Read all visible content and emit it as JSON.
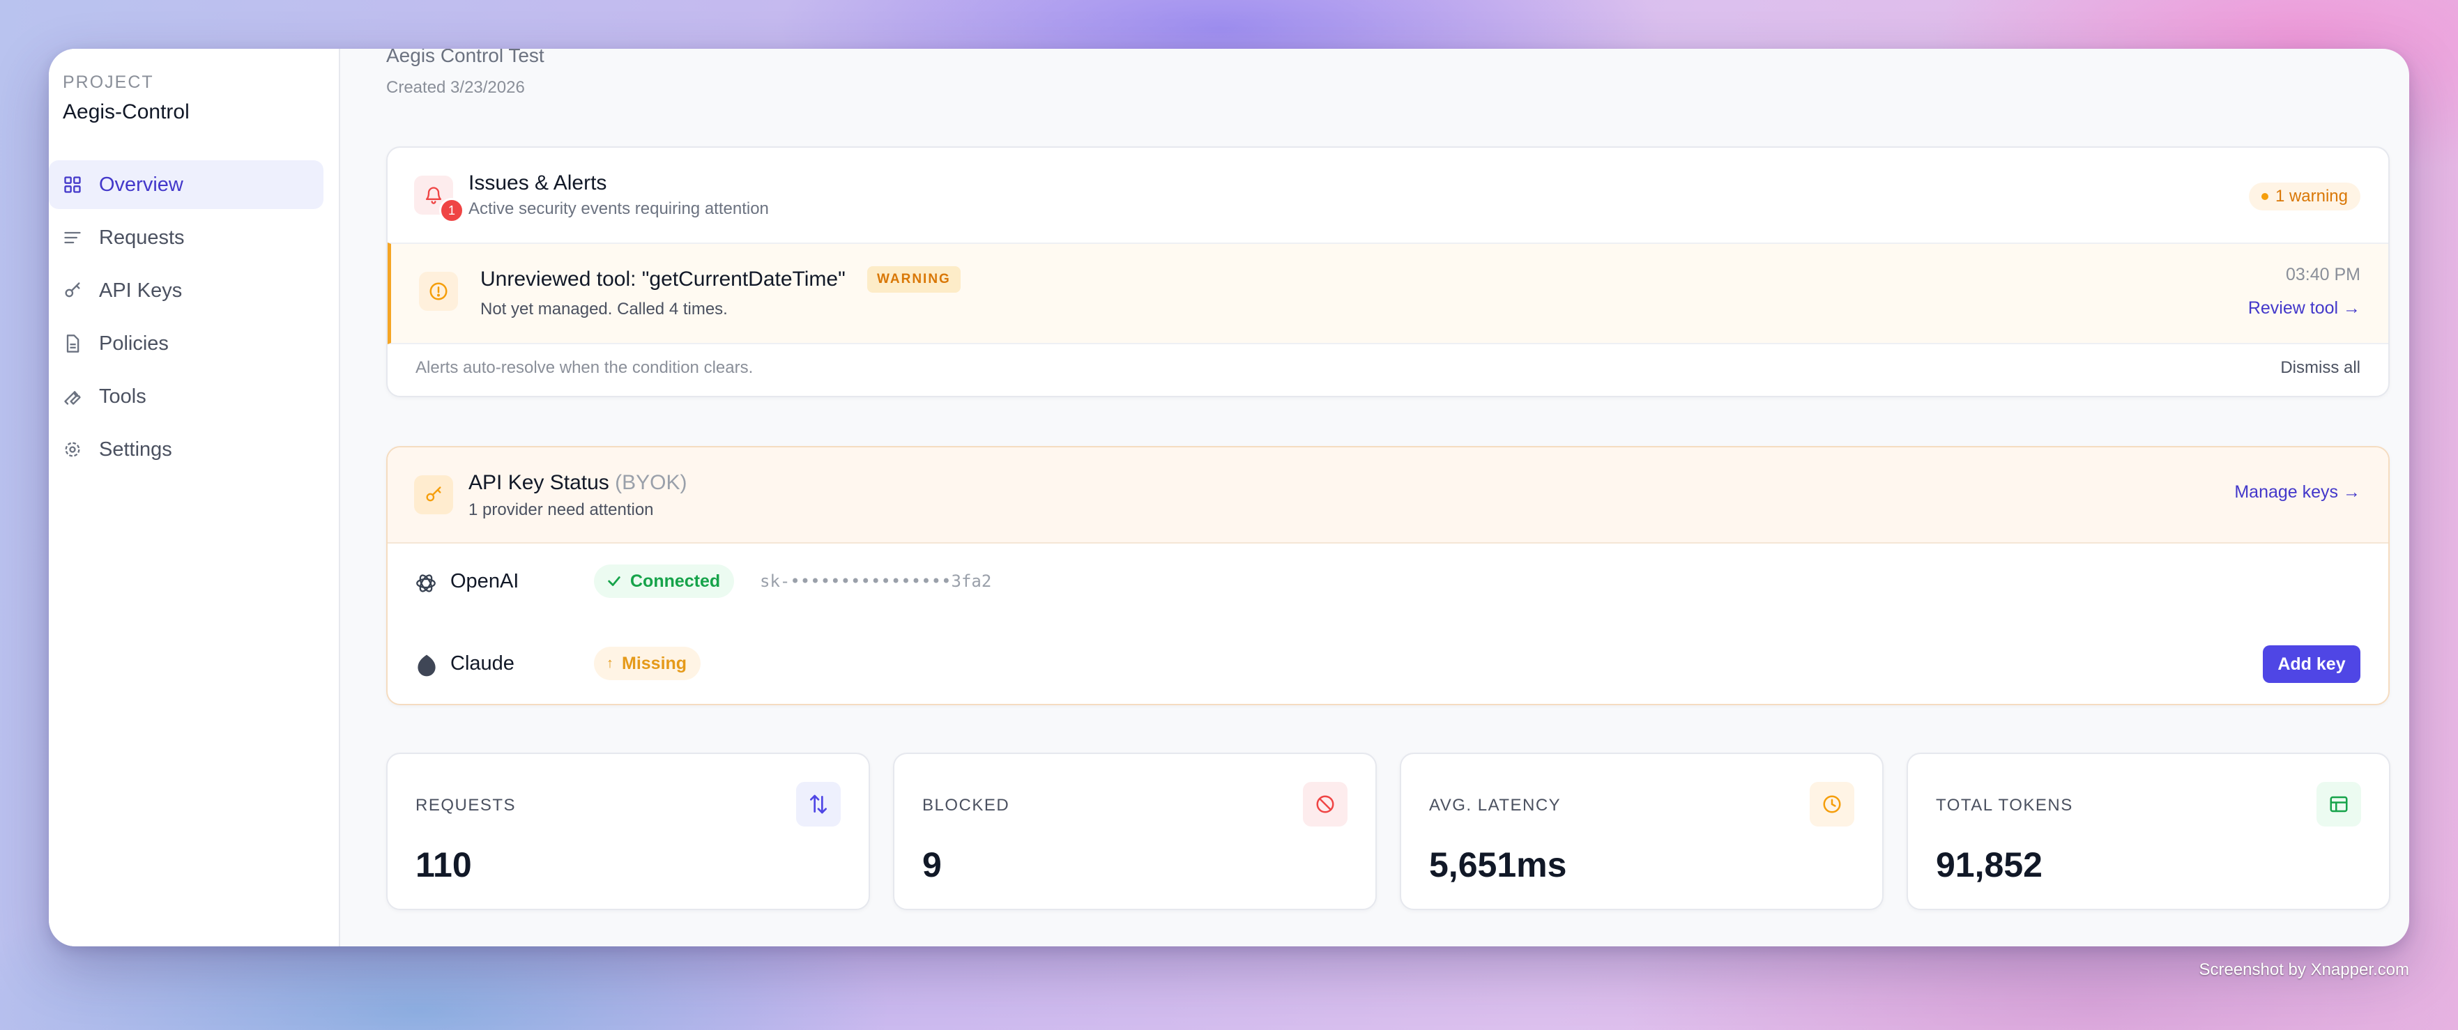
{
  "sidebar": {
    "project_label": "PROJECT",
    "project_name": "Aegis-Control",
    "items": [
      {
        "label": "Overview",
        "icon": "grid-icon",
        "active": true
      },
      {
        "label": "Requests",
        "icon": "list-icon"
      },
      {
        "label": "API Keys",
        "icon": "key-icon"
      },
      {
        "label": "Policies",
        "icon": "document-icon"
      },
      {
        "label": "Tools",
        "icon": "wrench-icon"
      },
      {
        "label": "Settings",
        "icon": "gear-icon"
      }
    ]
  },
  "header": {
    "title": "Aegis Control Test",
    "created": "Created 3/23/2026"
  },
  "alerts": {
    "title": "Issues & Alerts",
    "subtitle": "Active security events requiring attention",
    "badge_count": "1",
    "warning_pill": "1 warning",
    "item": {
      "title": "Unreviewed tool: \"getCurrentDateTime\"",
      "tag": "WARNING",
      "detail": "Not yet managed. Called 4 times.",
      "time": "03:40 PM",
      "action": "Review tool →"
    },
    "footer_note": "Alerts auto-resolve when the condition clears.",
    "dismiss": "Dismiss all"
  },
  "api_keys": {
    "title": "API Key Status",
    "title_suffix": "(BYOK)",
    "subtitle": "1 provider need attention",
    "manage": "Manage keys →",
    "providers": [
      {
        "name": "OpenAI",
        "status": "Connected",
        "masked_key": "sk-••••••••••••••••3fa2"
      },
      {
        "name": "Claude",
        "status": "Missing",
        "action": "Add key"
      }
    ]
  },
  "stats": [
    {
      "label": "REQUESTS",
      "value": "110",
      "icon": "arrows-swap-icon",
      "color": "#4f46e5"
    },
    {
      "label": "BLOCKED",
      "value": "9",
      "icon": "blocked-icon",
      "color": "#ef4444"
    },
    {
      "label": "AVG. LATENCY",
      "value": "5,651ms",
      "icon": "clock-icon",
      "color": "#f59e0b"
    },
    {
      "label": "TOTAL TOKENS",
      "value": "91,852",
      "icon": "table-icon",
      "color": "#16a34a"
    }
  ],
  "credit": "Screenshot by Xnapper.com"
}
